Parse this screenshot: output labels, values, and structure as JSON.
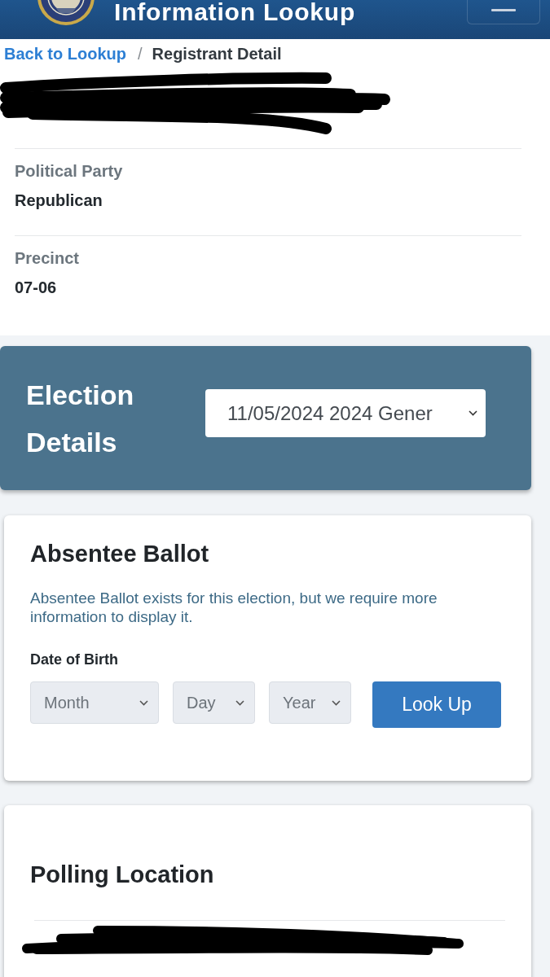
{
  "header": {
    "title": "Information Lookup"
  },
  "breadcrumb": {
    "link": "Back to Lookup",
    "separator": "/",
    "current": "Registrant Detail"
  },
  "registrant": {
    "name_redacted": true,
    "details": [
      {
        "label": "Political Party",
        "value": "Republican"
      },
      {
        "label": "Precinct",
        "value": "07-06"
      }
    ]
  },
  "election_details": {
    "title": "Election Details",
    "election_select": {
      "value": "11/05/2024 2024 Gener"
    }
  },
  "absentee_ballot": {
    "title": "Absentee Ballot",
    "message": "Absentee Ballot exists for this election, but we require more information to display it.",
    "date_of_birth": {
      "label": "Date of Birth",
      "selects": [
        {
          "placeholder": "Month"
        },
        {
          "placeholder": "Day"
        },
        {
          "placeholder": "Year"
        }
      ]
    },
    "button": "Look Up"
  },
  "polling_location": {
    "title": "Polling Location",
    "location_redacted": true
  }
}
